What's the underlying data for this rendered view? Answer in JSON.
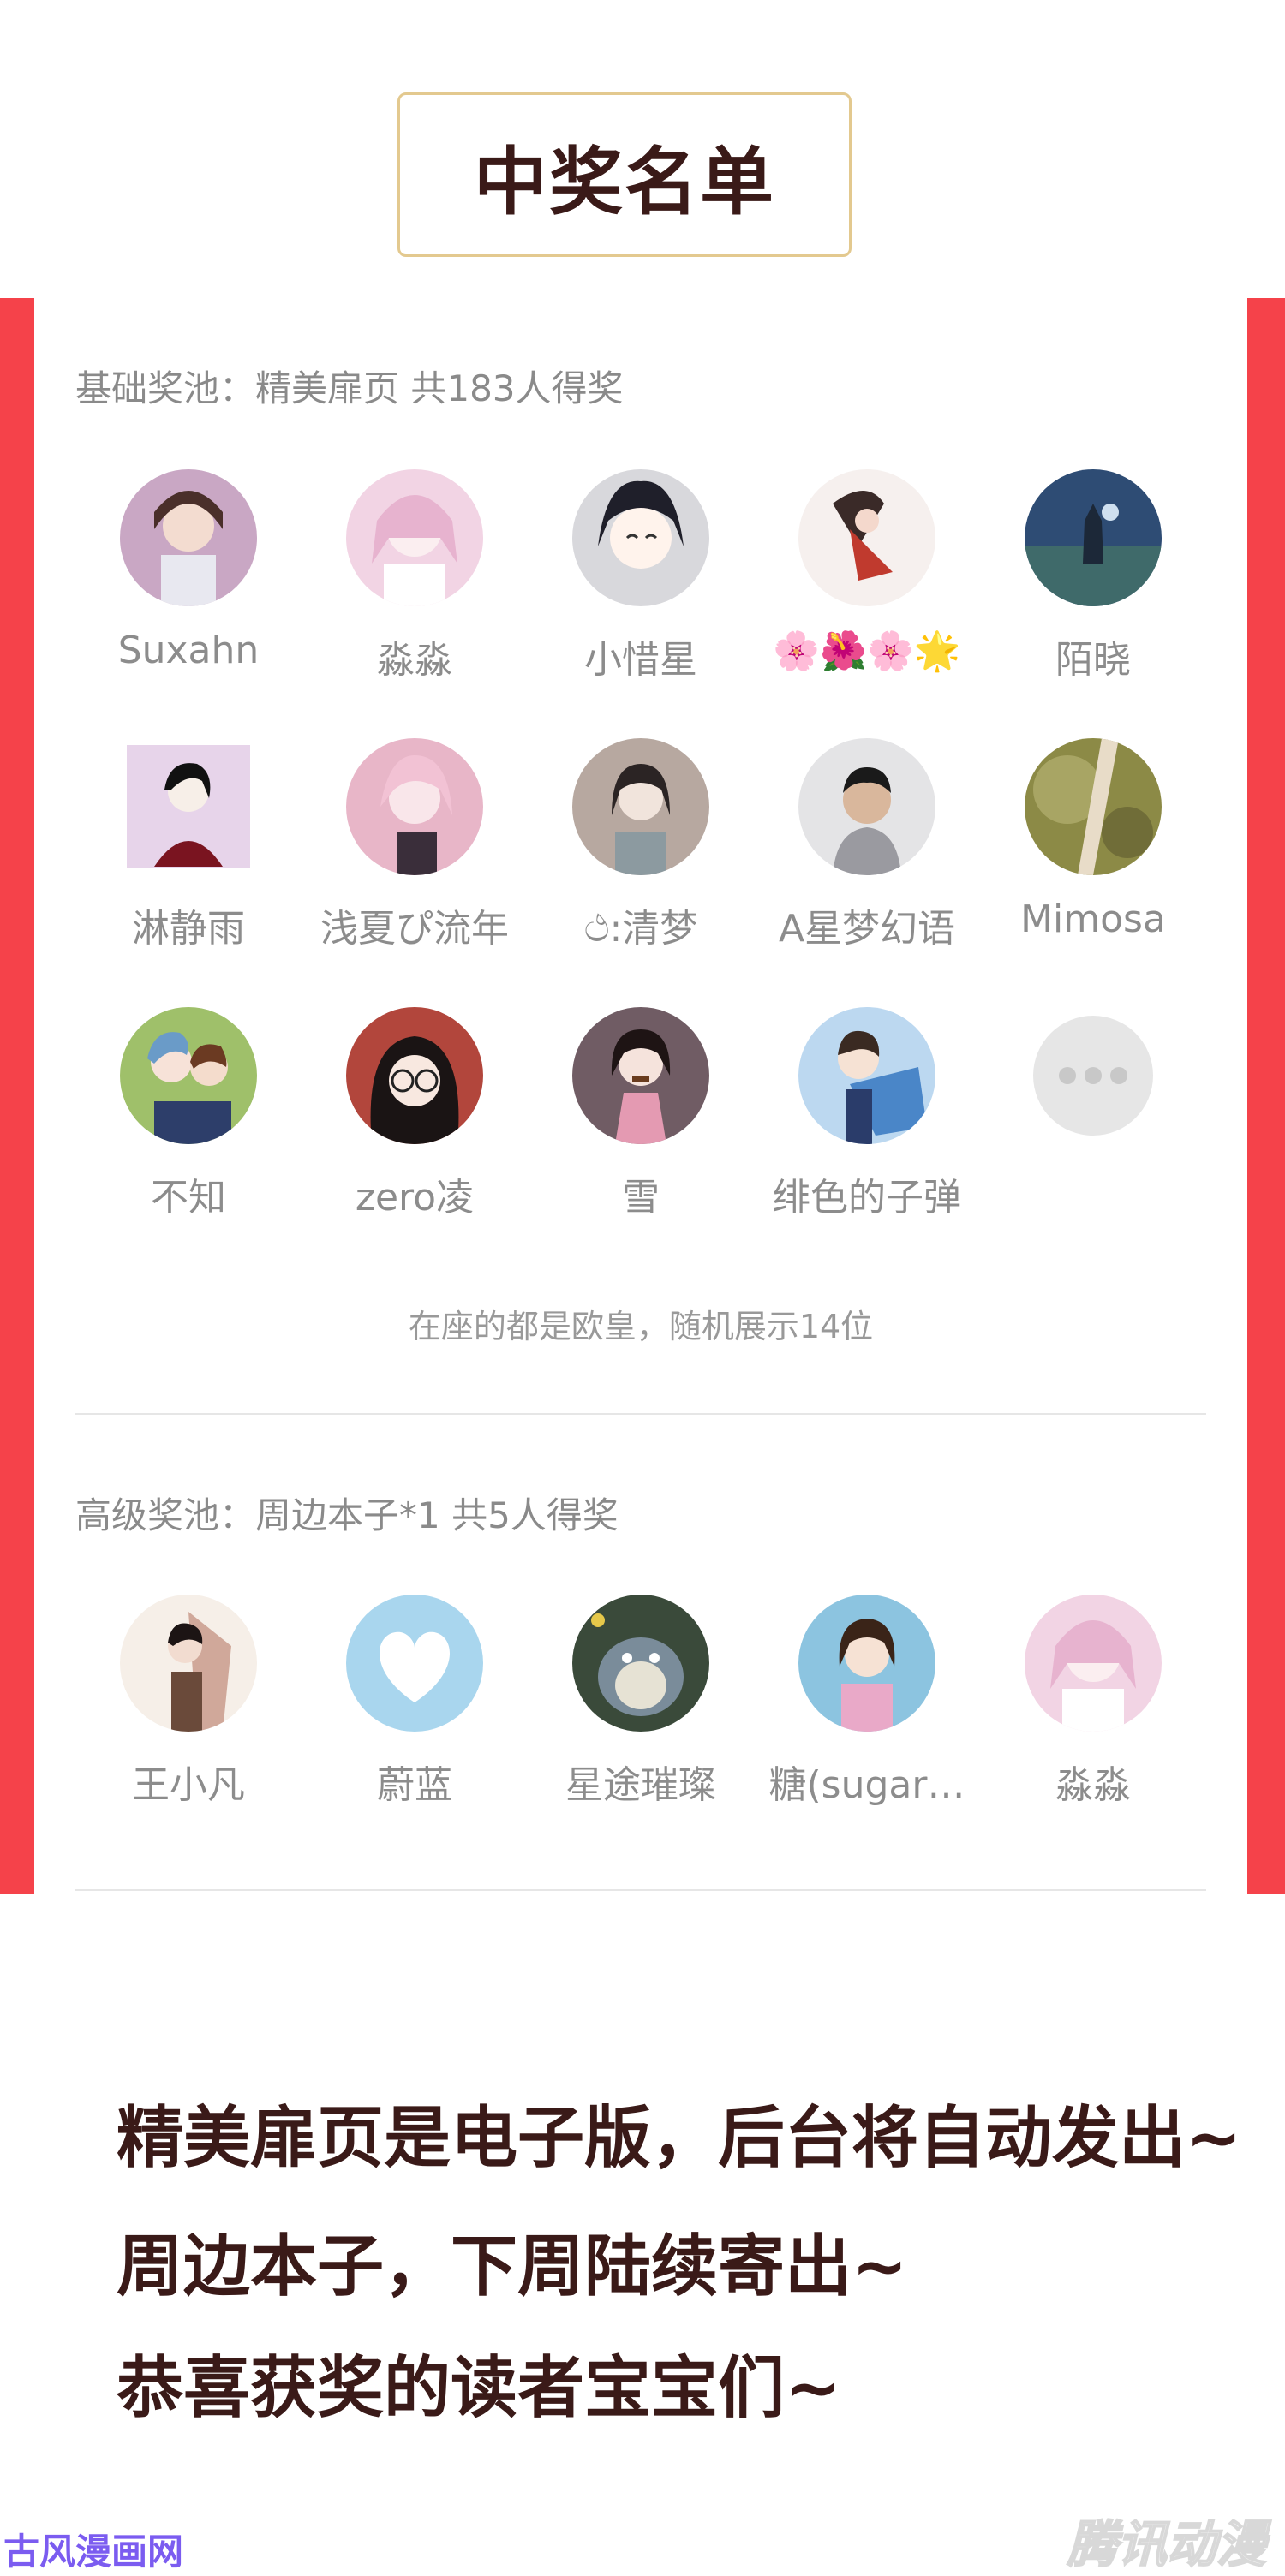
{
  "header": {
    "title": "中奖名单"
  },
  "basic_pool": {
    "label": "基础奖池：精美扉页 共183人得奖",
    "winners": [
      {
        "name": "Suxahn",
        "avatar_color": "#c9a7c4"
      },
      {
        "name": "淼淼",
        "avatar_color": "#f2d4e4"
      },
      {
        "name": "小惜星",
        "avatar_color": "#d8d8dc"
      },
      {
        "name": "🌸🌺🌸🌟",
        "avatar_color": "#c03a2e"
      },
      {
        "name": "陌晓",
        "avatar_color": "#2e4c74"
      },
      {
        "name": "淋静雨",
        "avatar_color": "#e7d4ea"
      },
      {
        "name": "浅夏ぴ流年",
        "avatar_color": "#e8b6c8"
      },
      {
        "name": "ථ:清梦",
        "avatar_color": "#b7a8a0"
      },
      {
        "name": "A星梦幻语",
        "avatar_color": "#9a9aa0"
      },
      {
        "name": "Mimosa",
        "avatar_color": "#8c8a46"
      },
      {
        "name": "不知",
        "avatar_color": "#6a9bc8"
      },
      {
        "name": "zero凌",
        "avatar_color": "#b2463c"
      },
      {
        "name": "雪",
        "avatar_color": "#705c64"
      },
      {
        "name": "绯色的子弹",
        "avatar_color": "#4a86c8"
      }
    ],
    "note": "在座的都是欧皇，随机展示14位"
  },
  "premium_pool": {
    "label": "高级奖池：周边本子*1 共5人得奖",
    "winners": [
      {
        "name": "王小凡",
        "avatar_color": "#d0a89a"
      },
      {
        "name": "蔚蓝",
        "avatar_color": "#a9d6ee"
      },
      {
        "name": "星途璀璨",
        "avatar_color": "#3a4a3a"
      },
      {
        "name": "糖(sugar…",
        "avatar_color": "#8cc4e0"
      },
      {
        "name": "淼淼",
        "avatar_color": "#f2d4e4"
      }
    ]
  },
  "bottom_lines": [
    "精美扉页是电子版，后台将自动发出~",
    "周边本子，下周陆续寄出~",
    "恭喜获奖的读者宝宝们~"
  ],
  "watermarks": {
    "left": "古风漫画网",
    "right": "腾讯动漫"
  },
  "colors": {
    "accent_red": "#f5424a",
    "title_border": "#e3c98f",
    "title_text": "#3a1a18"
  }
}
